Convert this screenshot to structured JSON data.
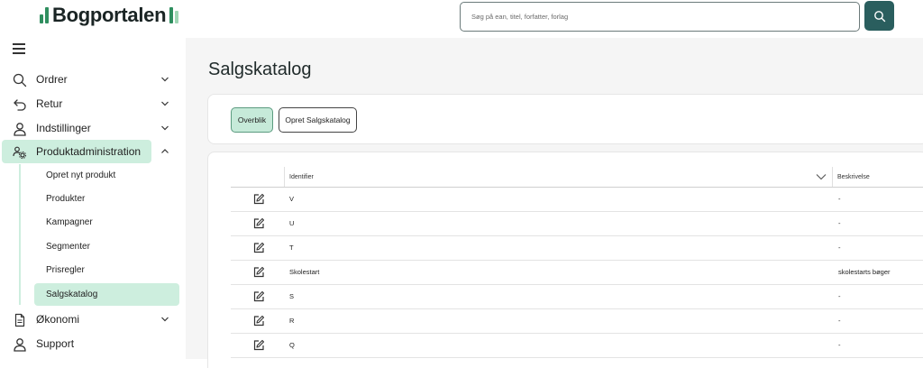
{
  "app": {
    "logo_text": "Bogportalen"
  },
  "search": {
    "placeholder": "Søg på ean, titel, forfatter, forlag",
    "value": ""
  },
  "sidebar": {
    "items": [
      {
        "label": "Ordrer",
        "icon": "search-icon",
        "expanded": false
      },
      {
        "label": "Retur",
        "icon": "undo-icon",
        "expanded": false
      },
      {
        "label": "Indstillinger",
        "icon": "user-icon",
        "expanded": false
      },
      {
        "label": "Produktadministration",
        "icon": "users-gear-icon",
        "expanded": true
      },
      {
        "label": "Økonomi",
        "icon": "document-icon",
        "expanded": false
      },
      {
        "label": "Support",
        "icon": "user-icon",
        "expanded": false
      }
    ],
    "subitems": [
      {
        "label": "Opret nyt produkt"
      },
      {
        "label": "Produkter"
      },
      {
        "label": "Kampagner"
      },
      {
        "label": "Segmenter"
      },
      {
        "label": "Prisregler"
      },
      {
        "label": "Salgskatalog",
        "active": true
      }
    ]
  },
  "main": {
    "title": "Salgskatalog",
    "tabs": {
      "overblik": "Overblik",
      "opret": "Opret Salgskatalog"
    },
    "table": {
      "columns": {
        "identifier": "Identifier",
        "beskrivelse": "Beskrivelse"
      },
      "rows": [
        {
          "identifier": "V",
          "beskrivelse": "-"
        },
        {
          "identifier": "U",
          "beskrivelse": "-"
        },
        {
          "identifier": "T",
          "beskrivelse": "-"
        },
        {
          "identifier": "Skolestart",
          "beskrivelse": "skolestarts bøger"
        },
        {
          "identifier": "S",
          "beskrivelse": "-"
        },
        {
          "identifier": "R",
          "beskrivelse": "-"
        },
        {
          "identifier": "Q",
          "beskrivelse": "-"
        }
      ]
    }
  },
  "colors": {
    "brand_green": "#2f8f5f",
    "active_bg": "#cdeede",
    "search_button": "#2a5e5e",
    "main_bg": "#f5f5f5"
  }
}
